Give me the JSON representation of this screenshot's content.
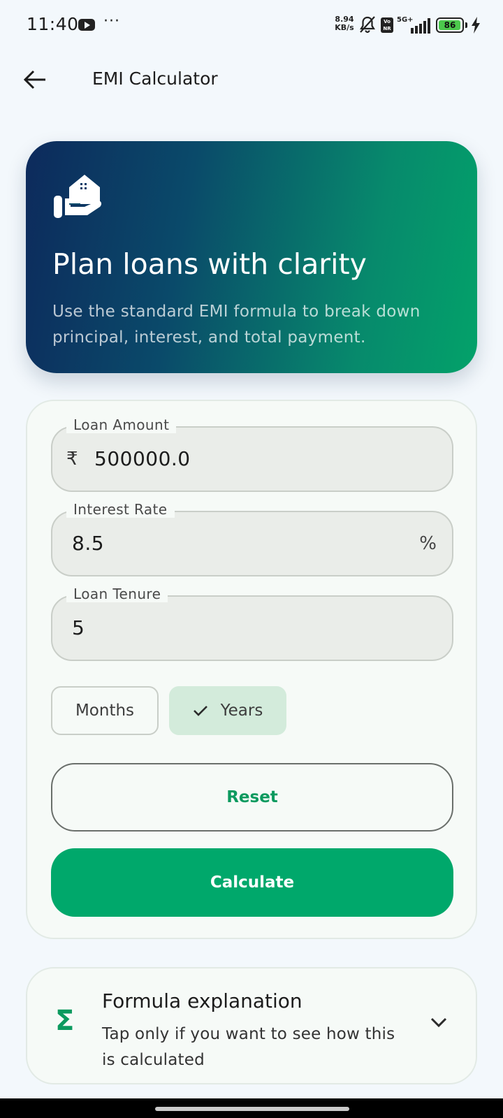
{
  "status_bar": {
    "time": "11:40",
    "net_speed_value": "8.94",
    "net_speed_unit": "KB/s",
    "volte": "Vo\nNR",
    "net_type": "5G+",
    "battery_level": "86",
    "icons": [
      "youtube-icon",
      "more-dots-icon",
      "bell-off-icon",
      "volte-icon",
      "signal-icon",
      "battery-icon",
      "charging-icon"
    ]
  },
  "app_bar": {
    "title": "EMI Calculator",
    "back_icon": "arrow-left-icon"
  },
  "hero": {
    "icon": "house-hand-icon",
    "title": "Plan loans with clarity",
    "subtitle": "Use the standard EMI formula to break down principal, interest, and total payment."
  },
  "form": {
    "loan_amount": {
      "label": "Loan Amount",
      "prefix": "₹",
      "value": "500000.0"
    },
    "interest_rate": {
      "label": "Interest Rate",
      "value": "8.5",
      "suffix": "%"
    },
    "loan_tenure": {
      "label": "Loan Tenure",
      "value": "5"
    },
    "tenure_unit": {
      "options": [
        "Months",
        "Years"
      ],
      "selected": "Years"
    },
    "reset_label": "Reset",
    "calculate_label": "Calculate"
  },
  "formula": {
    "icon": "sigma-icon",
    "title": "Formula explanation",
    "subtitle": "Tap only if you want to see how this is calculated"
  },
  "colors": {
    "accent": "#00a86b",
    "hero_gradient_start": "#0d2a5c",
    "hero_gradient_end": "#03a26a",
    "selected_chip": "#d3ebdb",
    "background": "#f3f8fc"
  }
}
